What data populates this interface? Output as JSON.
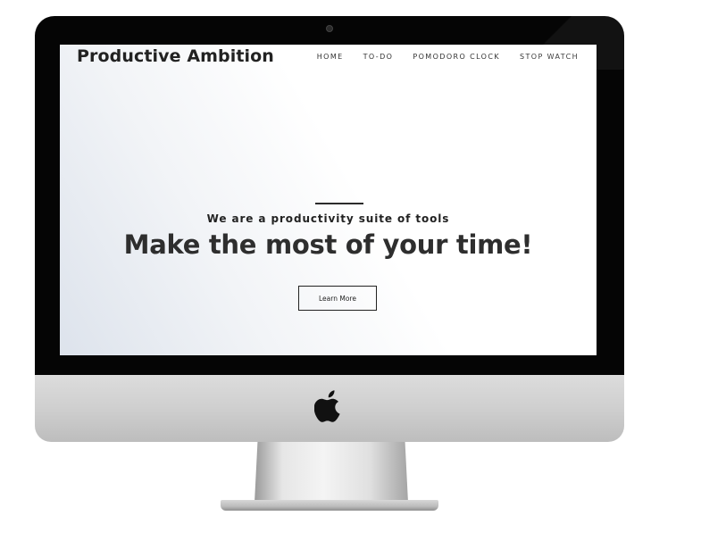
{
  "site": {
    "brand": "Productive Ambition",
    "nav": [
      {
        "label": "HOME"
      },
      {
        "label": "TO-DO"
      },
      {
        "label": "POMODORO CLOCK"
      },
      {
        "label": "STOP WATCH"
      }
    ]
  },
  "hero": {
    "tagline": "We are a productivity suite of tools",
    "headline": "Make the most of your time!",
    "cta_label": "Learn More"
  },
  "device": {
    "logo_icon": "apple-logo-icon",
    "bezel_color": "#050505",
    "body_color": "#cfcfcf"
  }
}
